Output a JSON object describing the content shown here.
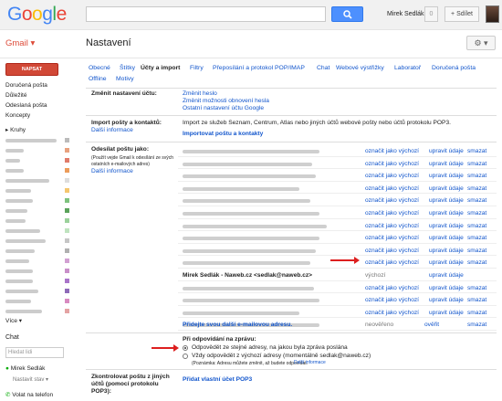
{
  "topbar": {
    "logo_text": "Google",
    "user_name": "Mirek Sedlák",
    "notifications": "0",
    "share_label": "+ Sdílet"
  },
  "subbar": {
    "app_label": "Gmail ▾",
    "page_title": "Nastavení",
    "gear_label": "⚙ ▾"
  },
  "sidebar": {
    "compose_label": "NAPSAT",
    "items": [
      "Doručená pošta",
      "Důležité",
      "Odeslaná pošta",
      "Koncepty"
    ],
    "circles_label": "Kruhy",
    "more_label": "Více ▾",
    "chat_title": "Chat",
    "chat_search_placeholder": "Hledat lidi",
    "chat_user": "Mirek Sedlák",
    "chat_status": "Nastavit stav",
    "call_label": "Volat na telefon"
  },
  "tabs": [
    "Obecné",
    "Štítky",
    "Účty a import",
    "Filtry",
    "Přeposílání a protokol POP/IMAP",
    "Chat",
    "Webové výstřižky",
    "Laboratoř",
    "Doručená pošta",
    "Offline",
    "Motivy"
  ],
  "sections": {
    "change_account": {
      "label": "Změnit nastavení účtu:",
      "links": [
        "Změnit heslo",
        "Změnit možnosti obnovení hesla",
        "Ostatní nastavení účtu Google"
      ]
    },
    "import": {
      "label": "Import pošty a kontaktů:",
      "more_info": "Další informace",
      "description": "Import ze služeb Seznam, Centrum, Atlas nebo jiných účtů webové pošty nebo účtů protokolu POP3.",
      "action": "Importovat poštu a kontakty"
    },
    "send_as": {
      "label": "Odesílat poštu jako:",
      "note_line1": "(Použít vejde Gmail k odesílání ze svých",
      "note_line2": "ostatních e-mailových adres)",
      "more_info": "Další informace",
      "make_default": "označit jako výchozí",
      "edit": "upravit údaje",
      "delete": "smazat",
      "highlighted_address": "Mirek Sedlák - Naweb.cz <sedlak@naweb.cz>",
      "default_label": "výchozí",
      "unverified_label": "neověřeno",
      "verify_label": "ověřit",
      "add_address": "Přidejte svou další e-mailovou adresu."
    },
    "reply": {
      "label": "Při odpovídání na zprávu:",
      "option1": "Odpovědět ze stejné adresy, na jakou byla zpráva poslána",
      "option2": "Vždy odpovědět z výchozí adresy (momentálně sedlak@naweb.cz)",
      "note": "(Poznámka: Adresu můžete změnit, až budete odpovídat.",
      "note_link": "Další informace"
    },
    "check_mail": {
      "label_line1": "Zkontrolovat poštu z jiných",
      "label_line2": "účtů (pomocí protokolu",
      "label_line3": "POP3):",
      "action": "Přidat vlastní účet POP3"
    }
  },
  "colors": {
    "brand_red": "#dd4b39",
    "link_blue": "#1155cc",
    "arrow_red": "#dd1f1f",
    "search_blue": "#4d90fe"
  }
}
